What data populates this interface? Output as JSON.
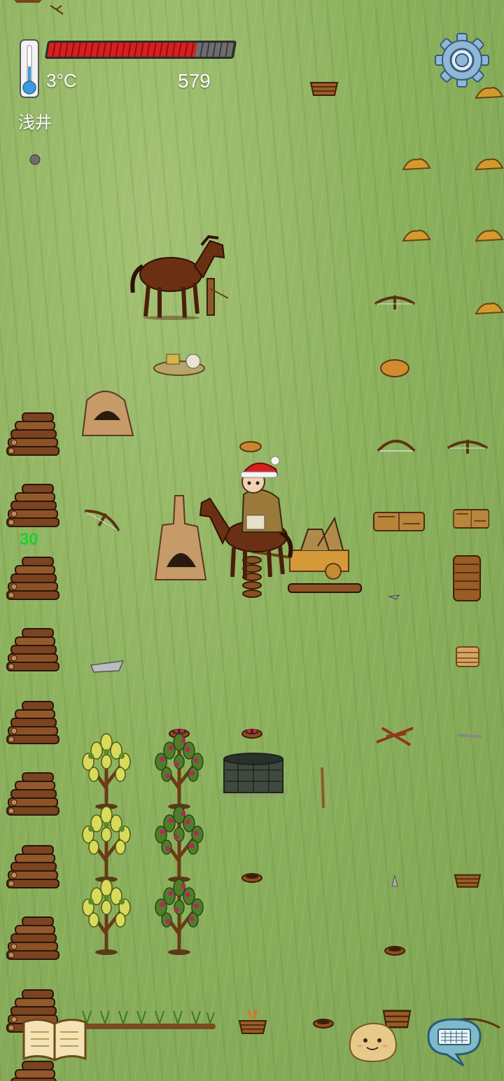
{
  "hud": {
    "temperature": "3°C",
    "score": "579",
    "location_name": "浅井",
    "hunger_fraction": 0.8,
    "floating_number": "30"
  },
  "colors": {
    "grass": "#8fb35f",
    "hunger_red": "#d62020",
    "floating_number_green": "#1fcf2e",
    "hud_text": "#ffffff"
  },
  "icons": {
    "settings": "gear-icon",
    "journal": "open-book-icon",
    "emote": "smiling-potato-face-icon",
    "chat": "keyboard-speech-bubble-icon",
    "temperature": "thermometer-icon"
  }
}
